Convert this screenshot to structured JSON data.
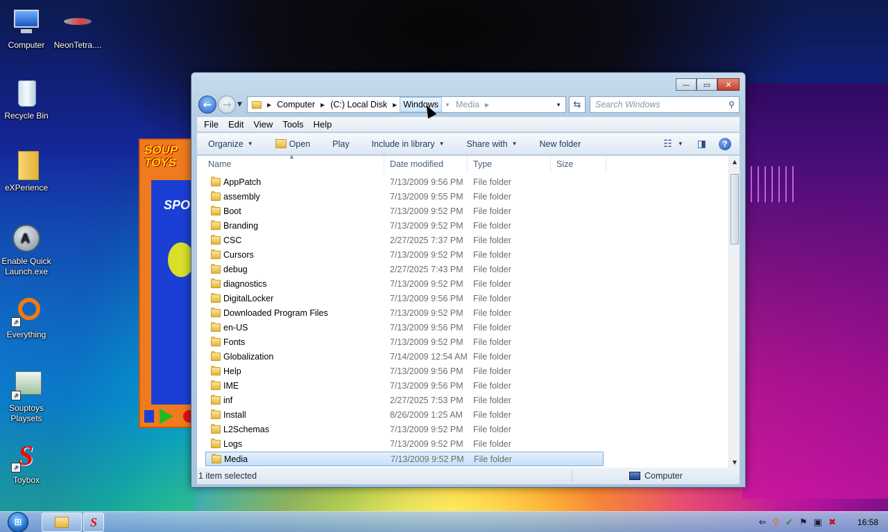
{
  "desktop": {
    "icons": [
      {
        "label": "Computer"
      },
      {
        "label": "NeonTetra...."
      },
      {
        "label": "Recycle Bin"
      },
      {
        "label": "eXPerience"
      },
      {
        "label": "Enable Quick Launch.exe"
      },
      {
        "label": "Everything"
      },
      {
        "label": "Souptoys Playsets"
      },
      {
        "label": "Toybox"
      }
    ]
  },
  "background_app": {
    "logo": "SOUP TOYS",
    "banner": "SPO"
  },
  "window": {
    "caption": {
      "minimize": "—",
      "maximize": "▭",
      "close": "✕"
    },
    "address": {
      "crumbs": [
        "Computer",
        "(C:) Local Disk",
        "Windows",
        "Media"
      ],
      "refresh_icon": "refresh-icon"
    },
    "search": {
      "placeholder": "Search Windows"
    },
    "menu": [
      "File",
      "Edit",
      "View",
      "Tools",
      "Help"
    ],
    "commands": {
      "organize": "Organize",
      "open": "Open",
      "play": "Play",
      "include": "Include in library",
      "share": "Share with",
      "newfolder": "New folder"
    },
    "columns": [
      "Name",
      "Date modified",
      "Type",
      "Size"
    ],
    "files": [
      {
        "name": "AppPatch",
        "date": "7/13/2009 9:56 PM",
        "type": "File folder"
      },
      {
        "name": "assembly",
        "date": "7/13/2009 9:55 PM",
        "type": "File folder"
      },
      {
        "name": "Boot",
        "date": "7/13/2009 9:52 PM",
        "type": "File folder"
      },
      {
        "name": "Branding",
        "date": "7/13/2009 9:52 PM",
        "type": "File folder"
      },
      {
        "name": "CSC",
        "date": "2/27/2025 7:37 PM",
        "type": "File folder"
      },
      {
        "name": "Cursors",
        "date": "7/13/2009 9:52 PM",
        "type": "File folder"
      },
      {
        "name": "debug",
        "date": "2/27/2025 7:43 PM",
        "type": "File folder"
      },
      {
        "name": "diagnostics",
        "date": "7/13/2009 9:52 PM",
        "type": "File folder"
      },
      {
        "name": "DigitalLocker",
        "date": "7/13/2009 9:56 PM",
        "type": "File folder"
      },
      {
        "name": "Downloaded Program Files",
        "date": "7/13/2009 9:52 PM",
        "type": "File folder"
      },
      {
        "name": "en-US",
        "date": "7/13/2009 9:56 PM",
        "type": "File folder"
      },
      {
        "name": "Fonts",
        "date": "7/13/2009 9:52 PM",
        "type": "File folder"
      },
      {
        "name": "Globalization",
        "date": "7/14/2009 12:54 AM",
        "type": "File folder"
      },
      {
        "name": "Help",
        "date": "7/13/2009 9:56 PM",
        "type": "File folder"
      },
      {
        "name": "IME",
        "date": "7/13/2009 9:56 PM",
        "type": "File folder"
      },
      {
        "name": "inf",
        "date": "2/27/2025 7:53 PM",
        "type": "File folder"
      },
      {
        "name": "Install",
        "date": "8/26/2009 1:25 AM",
        "type": "File folder"
      },
      {
        "name": "L2Schemas",
        "date": "7/13/2009 9:52 PM",
        "type": "File folder"
      },
      {
        "name": "Logs",
        "date": "7/13/2009 9:52 PM",
        "type": "File folder"
      },
      {
        "name": "Media",
        "date": "7/13/2009 9:52 PM",
        "type": "File folder"
      }
    ],
    "status": {
      "selection": "1 item selected",
      "location": "Computer"
    }
  },
  "taskbar": {
    "clock": "16:58"
  }
}
